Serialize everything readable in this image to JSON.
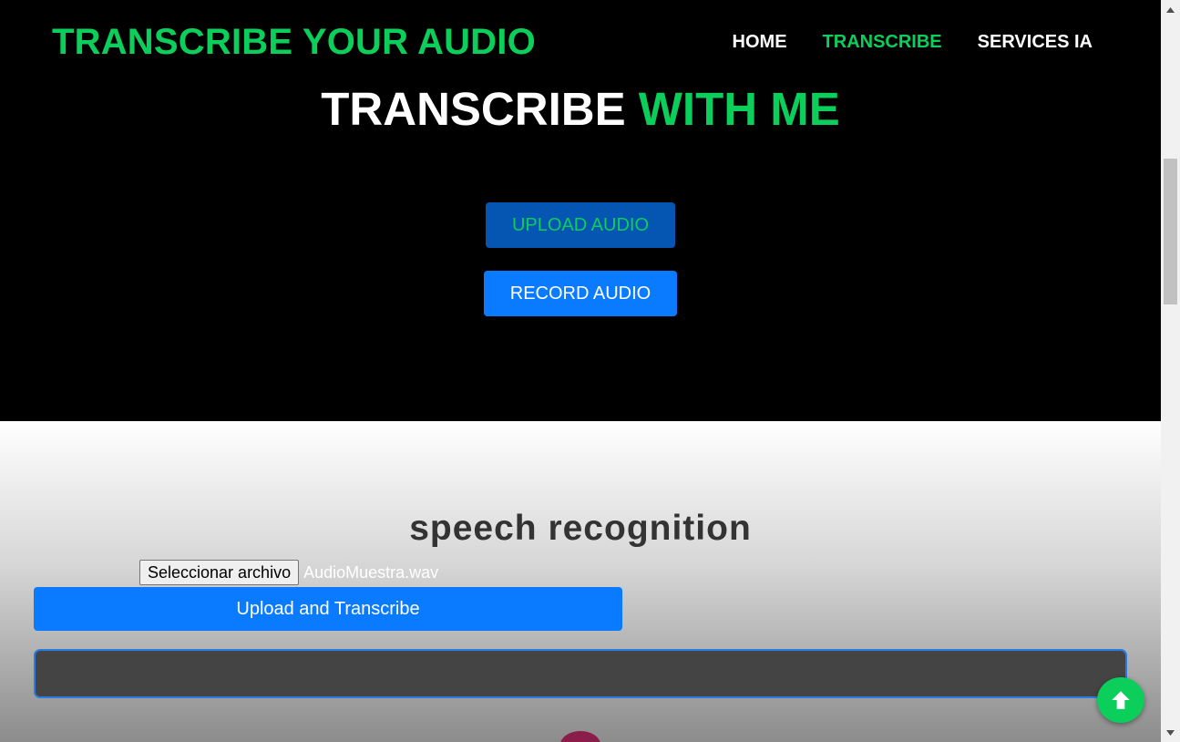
{
  "nav": {
    "brand": "TRANSCRIBE YOUR AUDIO",
    "links": [
      {
        "label": "HOME",
        "active": false
      },
      {
        "label": "TRANSCRIBE",
        "active": true
      },
      {
        "label": "SERVICES IA",
        "active": false
      }
    ]
  },
  "hero": {
    "title_part1": "TRANSCRIBE",
    "title_part2": "WITH ME",
    "upload_button": "UPLOAD AUDIO",
    "record_button": "RECORD AUDIO"
  },
  "speech": {
    "title": "speech recognition",
    "file_button": "Seleccionar archivo",
    "file_name": "AudioMuestra.wav",
    "submit_button": "Upload and Transcribe",
    "transcript": ""
  },
  "colors": {
    "accent_green": "#0cce5a",
    "primary_blue": "#0a7bff",
    "dark_blue": "#0555b3"
  },
  "icons": {
    "scroll_top": "arrow-up-icon",
    "scrollbar_up": "triangle-up-icon",
    "scrollbar_down": "triangle-down-icon"
  }
}
